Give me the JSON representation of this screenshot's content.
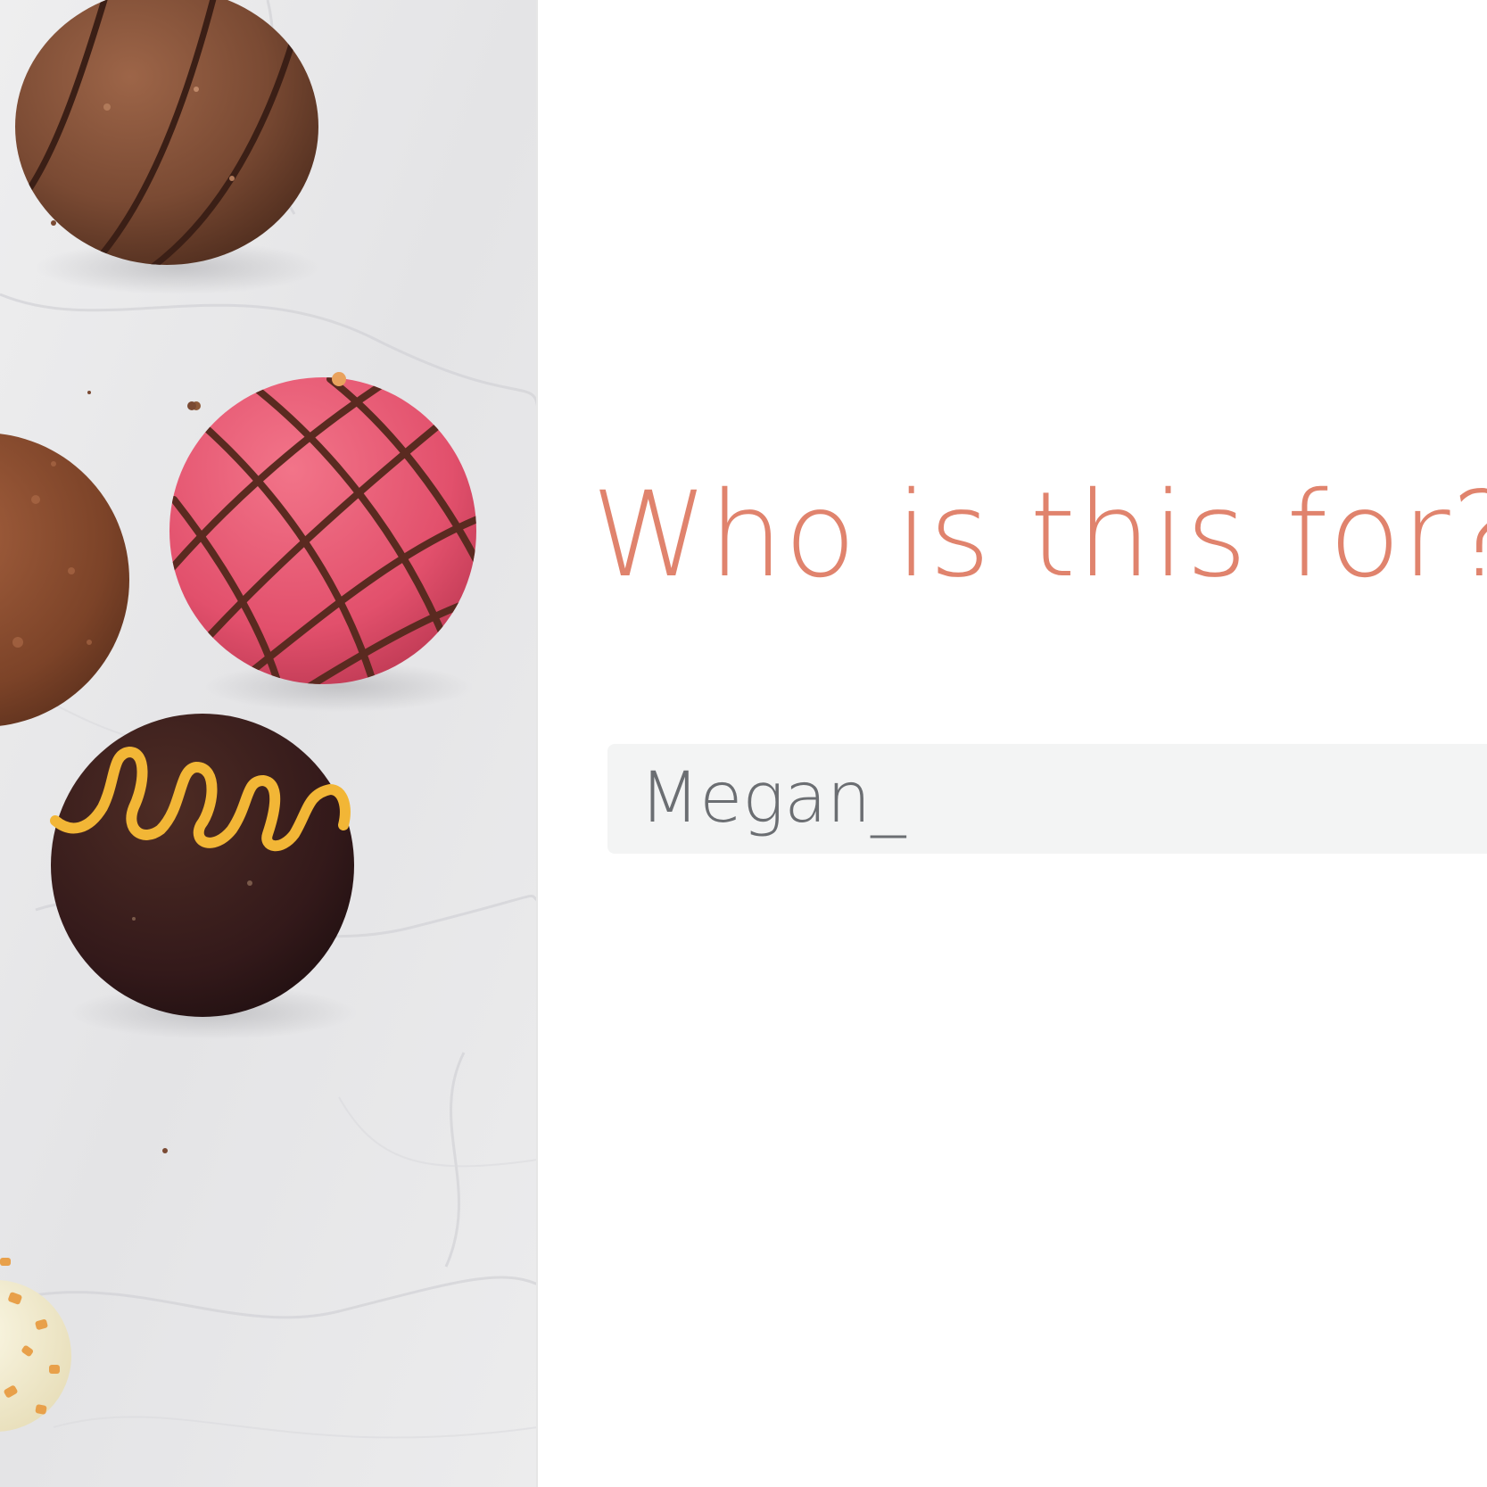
{
  "photo": {
    "subject": "chocolate-truffles-on-marble"
  },
  "form": {
    "question": "Who is this for?",
    "name_value": "Megan_"
  },
  "colors": {
    "question_text": "#e0836d",
    "input_background": "#f3f4f4",
    "input_text": "#6b6e72",
    "marble": "#e9e9eb"
  }
}
